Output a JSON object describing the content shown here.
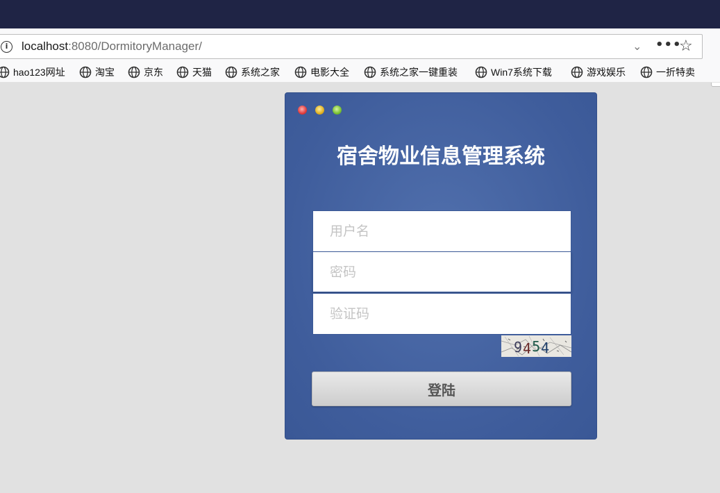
{
  "browser": {
    "url_host": "localhost",
    "url_path": ":8080/DormitoryManager/",
    "bookmarks": [
      {
        "label": "hao123网址",
        "icon": "globe-icon"
      },
      {
        "label": "淘宝",
        "icon": "globe-icon"
      },
      {
        "label": "京东",
        "icon": "globe-icon"
      },
      {
        "label": "天猫",
        "icon": "globe-icon"
      },
      {
        "label": "系统之家",
        "icon": "globe-icon"
      },
      {
        "label": "电影大全",
        "icon": "globe-icon"
      },
      {
        "label": "系统之家一键重装",
        "icon": "globe-icon"
      },
      {
        "label": "Win7系统下载",
        "icon": "globe-icon"
      },
      {
        "label": "游戏娱乐",
        "icon": "globe-icon"
      },
      {
        "label": "一折特卖",
        "icon": "globe-icon"
      }
    ]
  },
  "login": {
    "title": "宿舍物业信息管理系统",
    "username_placeholder": "用户名",
    "password_placeholder": "密码",
    "captcha_placeholder": "验证码",
    "captcha_text": "9454",
    "submit_label": "登陆"
  },
  "colors": {
    "card": "#4462a1",
    "page_bg": "#e1e1e1",
    "titlebar": "#1f2445"
  }
}
